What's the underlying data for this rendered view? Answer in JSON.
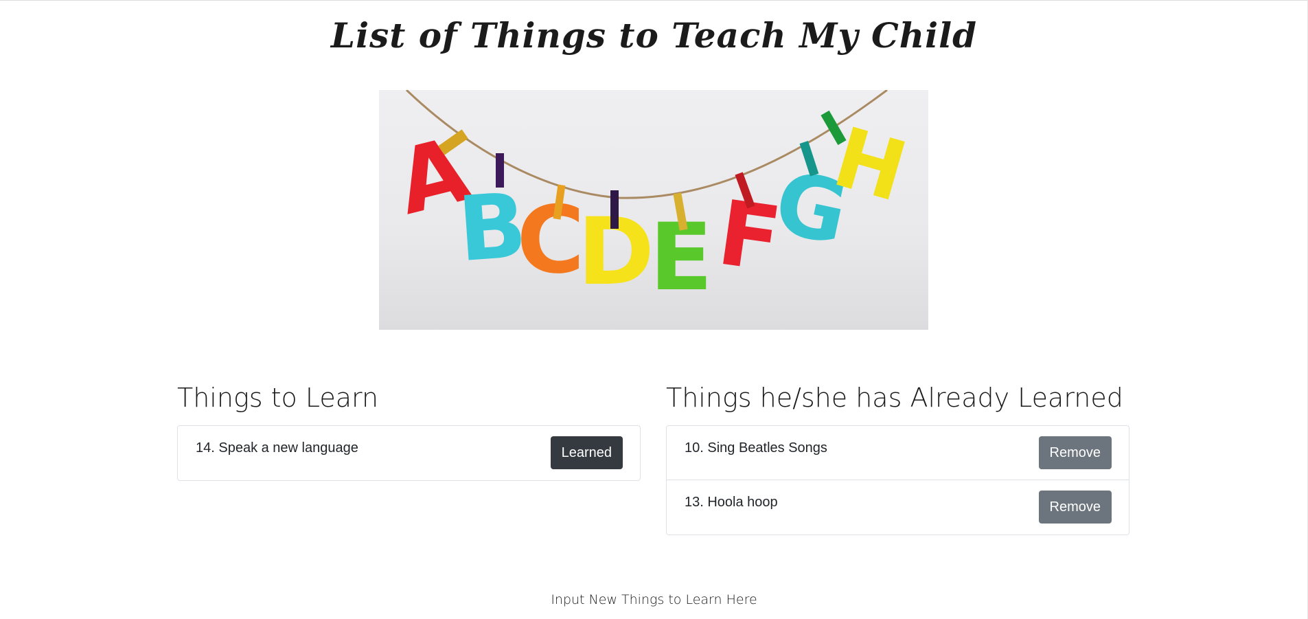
{
  "page": {
    "title": "List of Things to Teach My Child"
  },
  "hero_image": {
    "alt": "colorful felt letters A B C D E F G H hanging on a string with clothespins",
    "letters": [
      {
        "char": "A",
        "color": "#e8202a"
      },
      {
        "char": "B",
        "color": "#38c8d8"
      },
      {
        "char": "C",
        "color": "#f4781e"
      },
      {
        "char": "D",
        "color": "#f6e21a"
      },
      {
        "char": "E",
        "color": "#58c82a"
      },
      {
        "char": "F",
        "color": "#ea2230"
      },
      {
        "char": "G",
        "color": "#36c4d0"
      },
      {
        "char": "H",
        "color": "#f2e018"
      }
    ]
  },
  "to_learn": {
    "heading": "Things to Learn",
    "items": [
      {
        "text": "14. Speak a new language",
        "button": "Learned"
      }
    ]
  },
  "learned": {
    "heading": "Things he/she has Already Learned",
    "items": [
      {
        "text": "10. Sing Beatles Songs",
        "button": "Remove"
      },
      {
        "text": "13. Hoola hoop",
        "button": "Remove"
      }
    ]
  },
  "input_section": {
    "label": "Input New Things to Learn Here"
  },
  "colors": {
    "learned_button": "#343a40",
    "remove_button": "#6c757d",
    "border": "#dee2e6"
  }
}
